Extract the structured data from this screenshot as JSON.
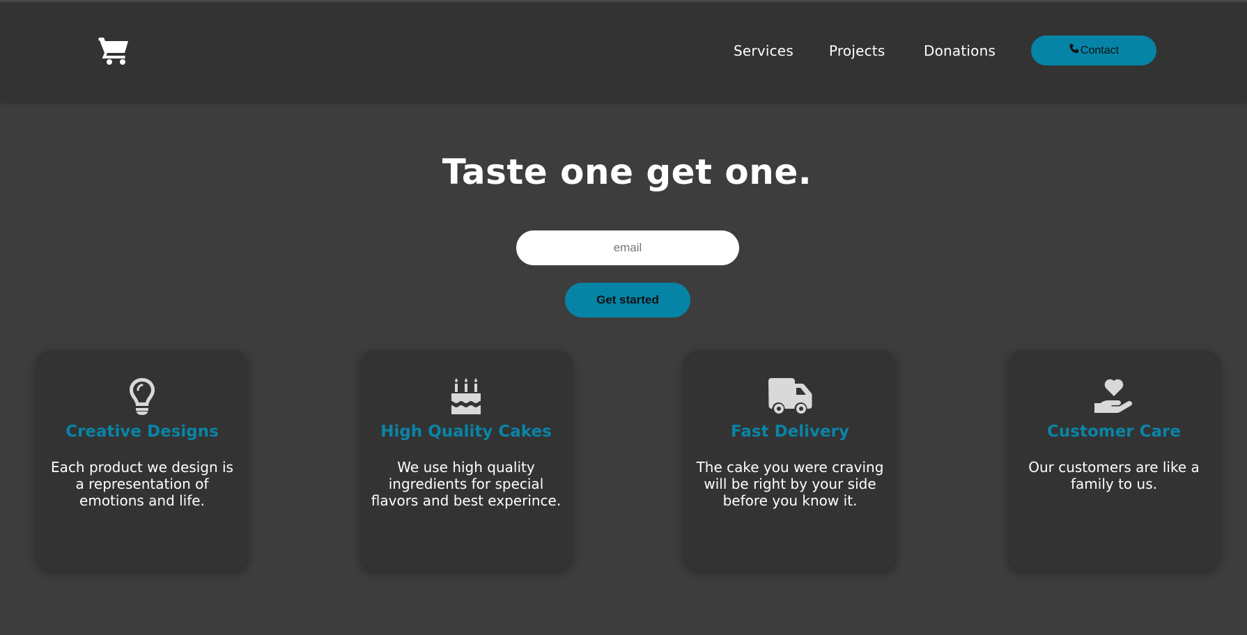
{
  "header": {
    "logo_icon": "shopping-cart-icon",
    "nav": [
      {
        "label": "Services"
      },
      {
        "label": "Projects"
      },
      {
        "label": "Donations"
      }
    ],
    "contact": {
      "icon": "phone-icon",
      "label": "Contact"
    }
  },
  "hero": {
    "title": "Taste one get one.",
    "email_placeholder": "email",
    "cta_label": "Get started"
  },
  "features": [
    {
      "icon": "lightbulb-icon",
      "title": "Creative Designs",
      "text": "Each product we design is a representation of emotions and life."
    },
    {
      "icon": "birthday-cake-icon",
      "title": "High Quality Cakes",
      "text": "We use high quality ingredients for special flavors and best experince."
    },
    {
      "icon": "delivery-truck-icon",
      "title": "Fast Delivery",
      "text": "The cake you were craving will be right by your side before you know it."
    },
    {
      "icon": "hand-holding-heart-icon",
      "title": "Customer Care",
      "text": "Our customers are like a family to us."
    }
  ],
  "colors": {
    "accent": "#0684a6",
    "background": "#3d3d3d",
    "header_bg": "#333333",
    "card_bg": "#333333"
  }
}
